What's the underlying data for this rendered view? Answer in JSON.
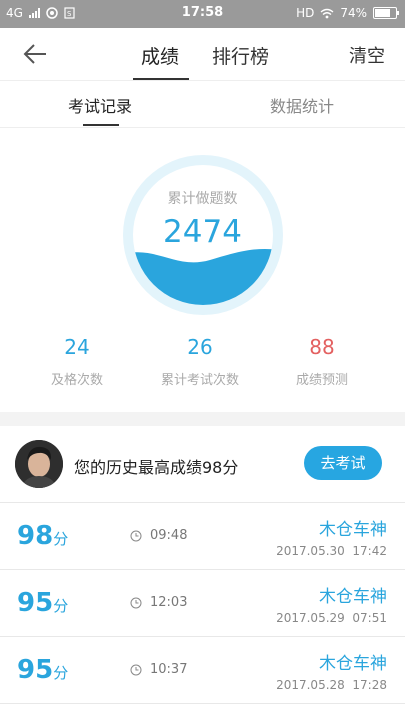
{
  "status_bar": {
    "network": "4G",
    "time": "17:58",
    "hd": "HD",
    "battery": "74%"
  },
  "nav": {
    "back_icon": "arrow-left-icon",
    "tab_score": "成绩",
    "tab_rank": "排行榜",
    "clear": "清空"
  },
  "subtabs": {
    "exam_records": "考试记录",
    "data_stats": "数据统计"
  },
  "gauge": {
    "label": "累计做题数",
    "value": "2474"
  },
  "stats": [
    {
      "value": "24",
      "label": "及格次数",
      "color": "#2aa5dd"
    },
    {
      "value": "26",
      "label": "累计考试次数",
      "color": "#2aa5dd"
    },
    {
      "value": "88",
      "label": "成绩预测",
      "color": "#e36060"
    }
  ],
  "best": {
    "text": "您的历史最高成绩98分",
    "button": "去考试"
  },
  "records": [
    {
      "score": "98",
      "unit": "分",
      "duration": "09:48",
      "name": "木仓车神",
      "date": "2017.05.30  17:42"
    },
    {
      "score": "95",
      "unit": "分",
      "duration": "12:03",
      "name": "木仓车神",
      "date": "2017.05.29  07:51"
    },
    {
      "score": "95",
      "unit": "分",
      "duration": "10:37",
      "name": "木仓车神",
      "date": "2017.05.28  17:28"
    }
  ],
  "colors": {
    "accent": "#2aa5dd",
    "predict": "#e36060",
    "status_bar": "#9a9a9a"
  }
}
